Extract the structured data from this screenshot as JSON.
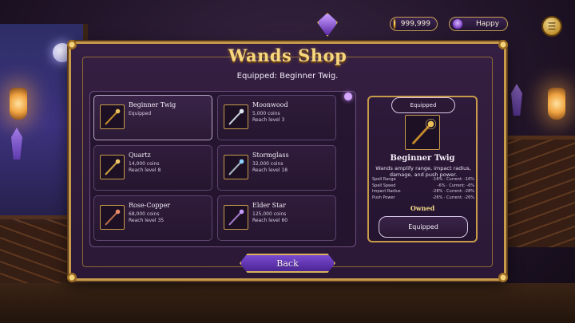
{
  "hud": {
    "coins": "999,999",
    "mood": "Happy",
    "icons": {
      "coin": "coin-icon",
      "mood": "mood-face-icon",
      "menu": "spellbook-icon"
    }
  },
  "shop": {
    "title": "Wands Shop",
    "equipped_message": "Equipped: Beginner Twig."
  },
  "wands": [
    {
      "name": "Beginner Twig",
      "line2": "Equipped",
      "line3": "",
      "gem": "#e8c05a",
      "shaft": "#c28a2c"
    },
    {
      "name": "Moonwood",
      "line2": "5,000 coins",
      "line3": "Reach level 3",
      "gem": "#dfe6f2",
      "shaft": "#c7ced9"
    },
    {
      "name": "Quartz",
      "line2": "14,000 coins",
      "line3": "Reach level 8",
      "gem": "#f0c76a",
      "shaft": "#caa043"
    },
    {
      "name": "Stormglass",
      "line2": "32,000 coins",
      "line3": "Reach level 18",
      "gem": "#8fd4ff",
      "shaft": "#a8b6c4"
    },
    {
      "name": "Rose-Copper",
      "line2": "68,000 coins",
      "line3": "Reach level 35",
      "gem": "#e98a6a",
      "shaft": "#b56a4a"
    },
    {
      "name": "Elder Star",
      "line2": "125,000 coins",
      "line3": "Reach level 60",
      "gem": "#c69cff",
      "shaft": "#a07ac8"
    }
  ],
  "detail": {
    "tag": "Equipped",
    "name": "Beginner Twig",
    "description": "Wands amplify range, impact radius, damage, and push power.",
    "stats": [
      {
        "label": "Spell Range",
        "value": "-16% · Current: -16%"
      },
      {
        "label": "Spell Speed",
        "value": "-6% · Current: -6%"
      },
      {
        "label": "Impact Radius",
        "value": "-28% · Current: -28%"
      },
      {
        "label": "Push Power",
        "value": "-26% · Current: -26%"
      }
    ],
    "status": "Owned",
    "button": "Equipped"
  },
  "back_label": "Back",
  "colors": {
    "gold": "#c89b4a",
    "panel": "#351f42",
    "accent_purple": "#7a4ad0",
    "title_gold": "#f7d77e"
  }
}
